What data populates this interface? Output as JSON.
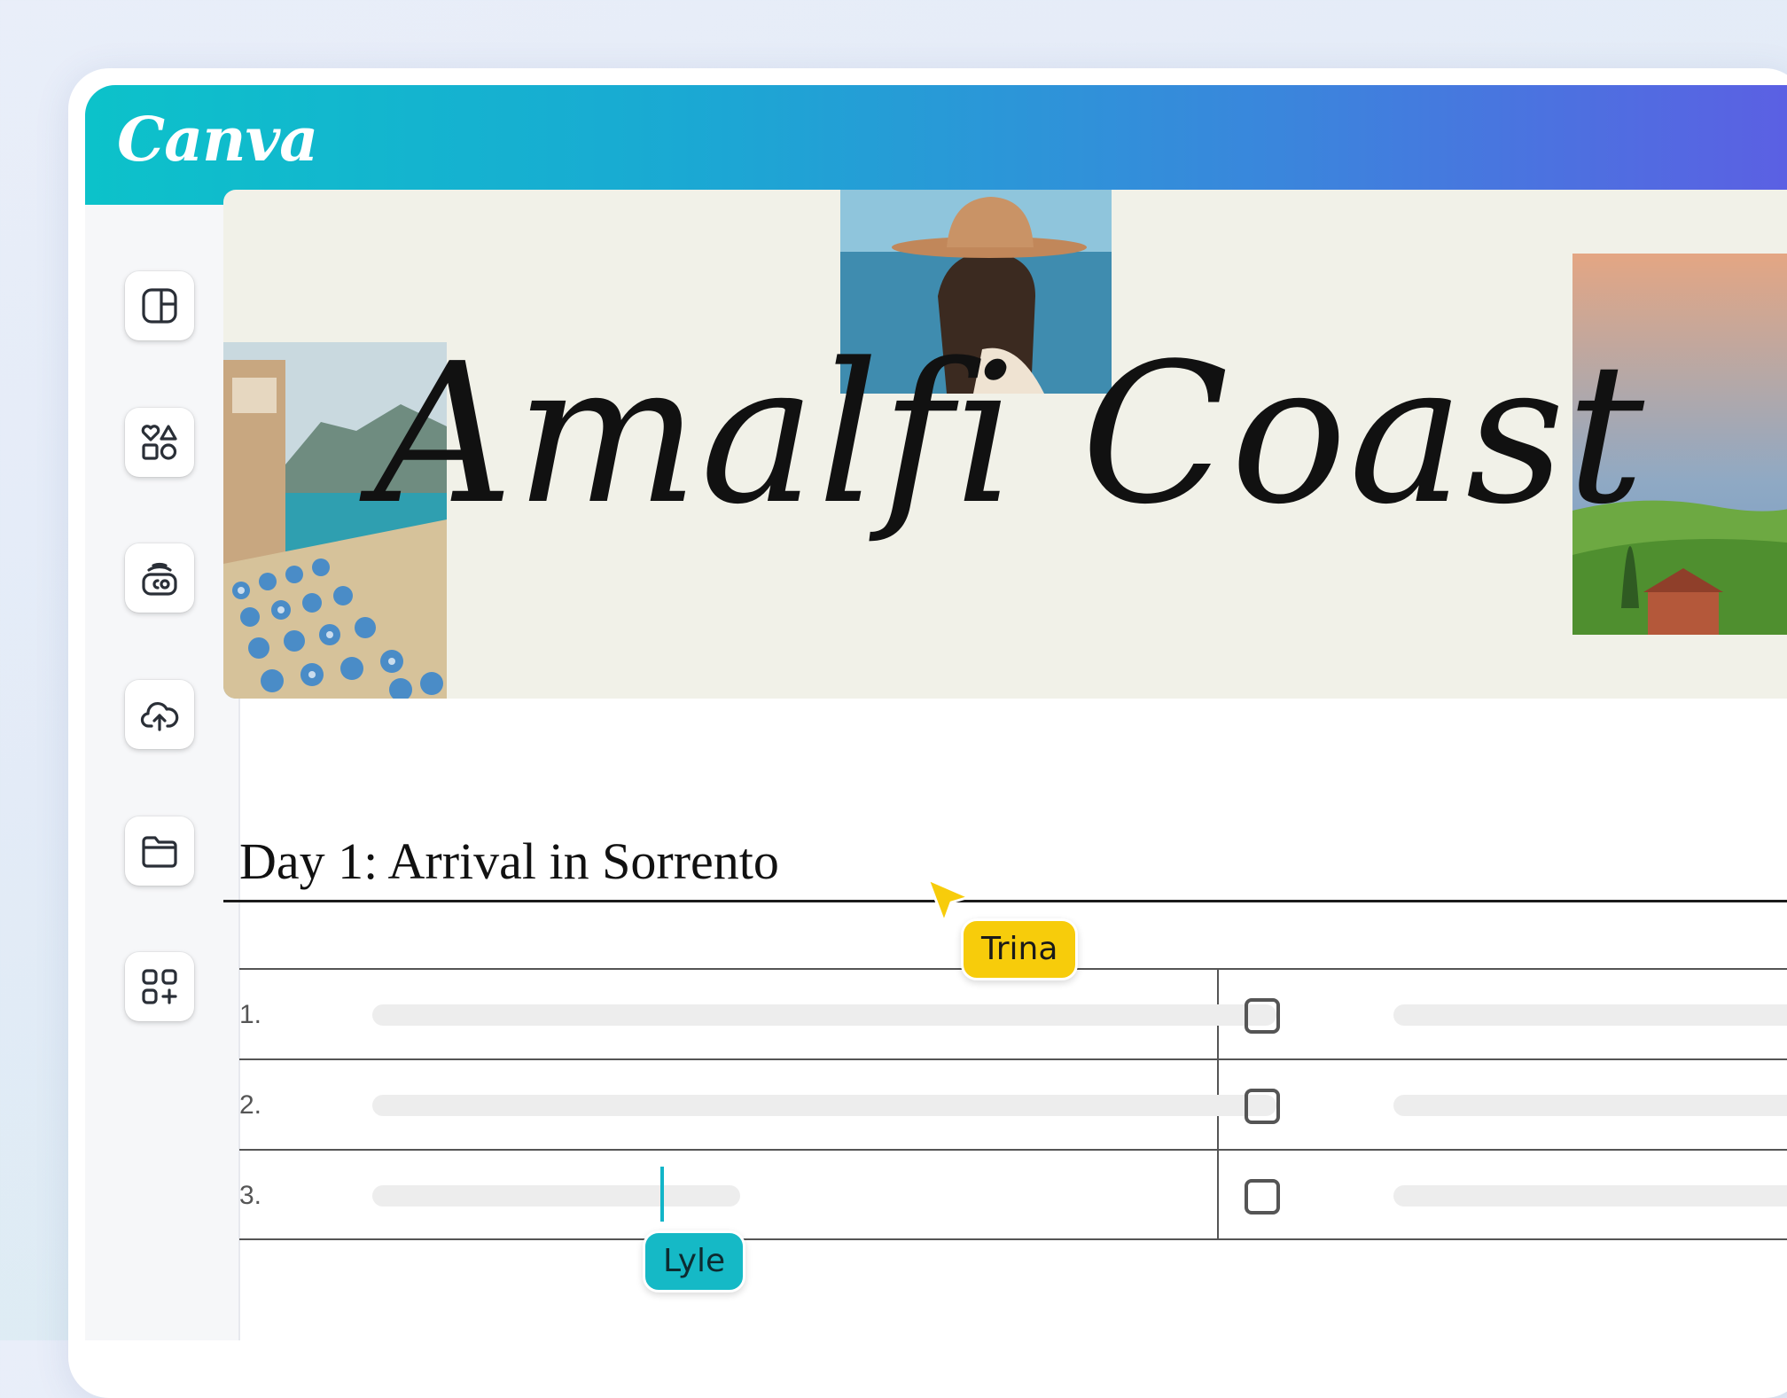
{
  "app": {
    "logo_text": "Canva",
    "header_gradient": [
      "#0cc2ca",
      "#5b60e3"
    ]
  },
  "sidebar": {
    "items": [
      {
        "icon": "layout-icon"
      },
      {
        "icon": "elements-icon"
      },
      {
        "icon": "brand-kit-icon"
      },
      {
        "icon": "upload-cloud-icon"
      },
      {
        "icon": "folder-icon"
      },
      {
        "icon": "apps-icon"
      }
    ]
  },
  "banner": {
    "title": "Amalfi Coast",
    "background": "#f1f1e8"
  },
  "itinerary": {
    "heading": "Day 1: Arrival in Sorrento",
    "rows": [
      {
        "number": "1."
      },
      {
        "number": "2."
      },
      {
        "number": "3."
      }
    ]
  },
  "collaborators": {
    "trina": {
      "name": "Trina",
      "color": "#f7cc0b"
    },
    "lyle": {
      "name": "Lyle",
      "color": "#15b9c6"
    }
  }
}
